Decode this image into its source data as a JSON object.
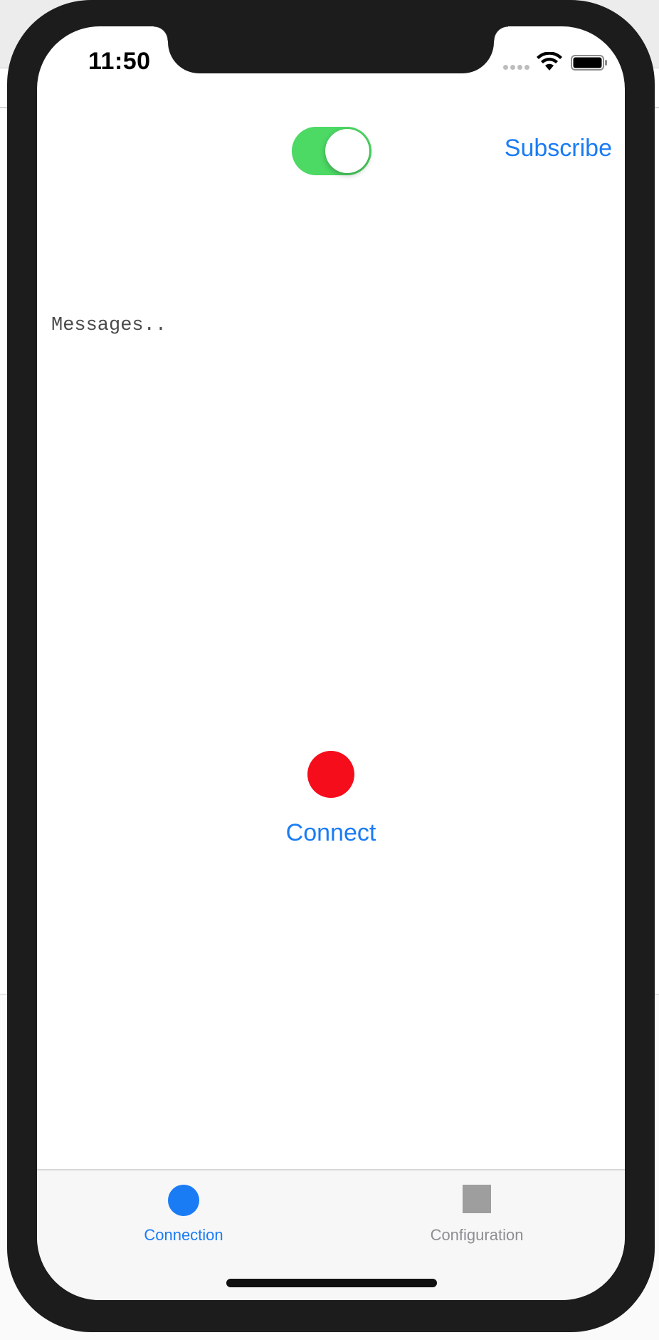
{
  "status_bar": {
    "time": "11:50",
    "signal_icon": "signal-dots-icon",
    "wifi_icon": "wifi-icon",
    "battery_icon": "battery-full-icon"
  },
  "header": {
    "toggle_state": "on",
    "toggle_color": "#4cd964",
    "subscribe_label": "Subscribe"
  },
  "messages": {
    "placeholder": "Messages.."
  },
  "connection": {
    "status_color": "#f50d1c",
    "connect_label": "Connect"
  },
  "tabbar": {
    "tabs": [
      {
        "label": "Connection",
        "icon": "circle-icon",
        "selected": true,
        "color": "#1a7cf5"
      },
      {
        "label": "Configuration",
        "icon": "square-icon",
        "selected": false,
        "color": "#8e8e93"
      }
    ]
  },
  "theme": {
    "accent": "#1a7cf5"
  }
}
